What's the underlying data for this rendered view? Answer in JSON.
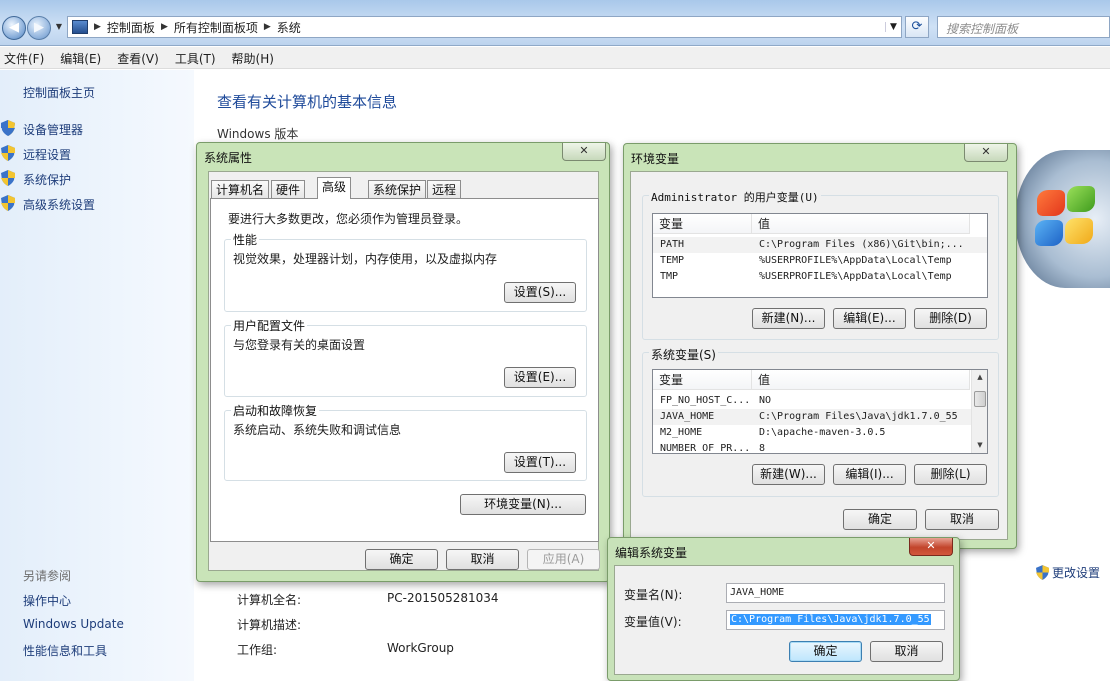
{
  "address_bar": {
    "crumbs": [
      "控制面板",
      "所有控制面板项",
      "系统"
    ],
    "search_placeholder": "搜索控制面板"
  },
  "menu": [
    "文件(F)",
    "编辑(E)",
    "查看(V)",
    "工具(T)",
    "帮助(H)"
  ],
  "sidebar": {
    "home": "控制面板主页",
    "links": [
      "设备管理器",
      "远程设置",
      "系统保护",
      "高级系统设置"
    ],
    "see_also_label": "另请参阅",
    "see_also": [
      "操作中心",
      "Windows Update",
      "性能信息和工具"
    ]
  },
  "main": {
    "title": "查看有关计算机的基本信息",
    "windows_version_label": "Windows 版本",
    "computer_info": [
      {
        "key": "计算机全名:",
        "value": "PC-201505281034"
      },
      {
        "key": "计算机描述:",
        "value": ""
      },
      {
        "key": "工作组:",
        "value": "WorkGroup"
      }
    ],
    "change_settings": "更改设置"
  },
  "sys_props": {
    "title": "系统属性",
    "tabs": [
      "计算机名",
      "硬件",
      "高级",
      "系统保护",
      "远程"
    ],
    "active_tab": "高级",
    "admin_note": "要进行大多数更改，您必须作为管理员登录。",
    "groups": [
      {
        "label": "性能",
        "desc": "视觉效果，处理器计划，内存使用，以及虚拟内存",
        "button": "设置(S)..."
      },
      {
        "label": "用户配置文件",
        "desc": "与您登录有关的桌面设置",
        "button": "设置(E)..."
      },
      {
        "label": "启动和故障恢复",
        "desc": "系统启动、系统失败和调试信息",
        "button": "设置(T)..."
      }
    ],
    "env_button": "环境变量(N)...",
    "ok": "确定",
    "cancel": "取消",
    "apply": "应用(A)"
  },
  "env_vars": {
    "title": "环境变量",
    "user_label": "Administrator 的用户变量(U)",
    "col_var": "变量",
    "col_val": "值",
    "user_rows": [
      {
        "name": "PATH",
        "value": "C:\\Program Files (x86)\\Git\\bin;..."
      },
      {
        "name": "TEMP",
        "value": "%USERPROFILE%\\AppData\\Local\\Temp"
      },
      {
        "name": "TMP",
        "value": "%USERPROFILE%\\AppData\\Local\\Temp"
      }
    ],
    "system_label": "系统变量(S)",
    "system_rows": [
      {
        "name": "FP_NO_HOST_C...",
        "value": "NO"
      },
      {
        "name": "JAVA_HOME",
        "value": "C:\\Program Files\\Java\\jdk1.7.0_55"
      },
      {
        "name": "M2_HOME",
        "value": "D:\\apache-maven-3.0.5"
      },
      {
        "name": "NUMBER_OF_PR...",
        "value": "8"
      }
    ],
    "user_buttons": [
      "新建(N)...",
      "编辑(E)...",
      "删除(D)"
    ],
    "system_buttons": [
      "新建(W)...",
      "编辑(I)...",
      "删除(L)"
    ],
    "ok": "确定",
    "cancel": "取消"
  },
  "edit_var": {
    "title": "编辑系统变量",
    "name_label": "变量名(N):",
    "name_value": "JAVA_HOME",
    "value_label": "变量值(V):",
    "value_value": "C:\\Program Files\\Java\\jdk1.7.0_55",
    "ok": "确定",
    "cancel": "取消"
  }
}
